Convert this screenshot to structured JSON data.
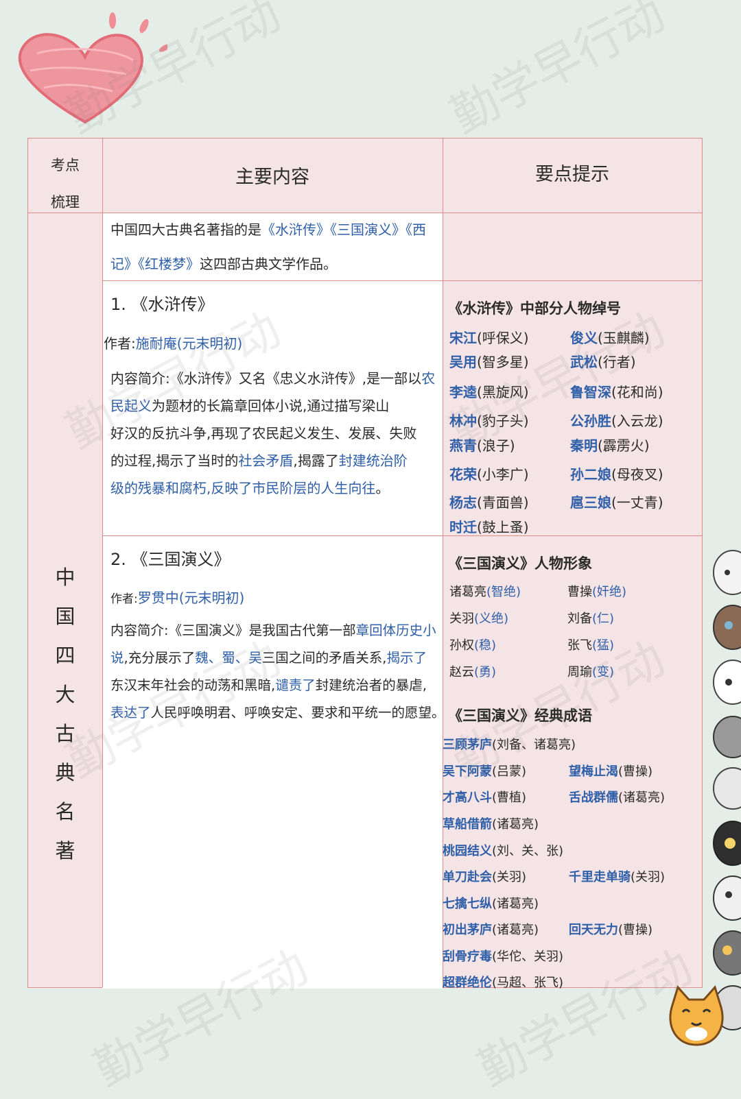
{
  "watermark": "勤学早行动",
  "header": {
    "col1_line1": "考点",
    "col1_line2": "梳理",
    "col2": "主要内容",
    "col3": "要点提示"
  },
  "side_title": [
    "中",
    "国",
    "四",
    "大",
    "古",
    "典",
    "名",
    "著"
  ],
  "intro": {
    "a": "中国四大古典名著指的是",
    "b": "《水浒传》《三国演义》《西",
    "c": "记》《红楼梦》",
    "d": "这四部古典文学作品。"
  },
  "shuihu": {
    "title": "1. 《水浒传》",
    "author_label": "作者:",
    "author": "施耐庵(元末明初)",
    "l1_a": "内容简介:《水浒传》又名《忠义水浒传》,是一部以",
    "l1_b": "农",
    "l2_a": "民起义",
    "l2_b": "为题材的长篇章回体小说,通过描写梁山",
    "l3": "好汉的反抗斗争,再现了农民起义发生、发展、失败",
    "l4_a": "的过程,揭示了当时的",
    "l4_b": "社会矛盾",
    "l4_c": ",揭露了",
    "l4_d": "封建统治阶",
    "l5_a": "级的残暴和腐朽,反映了市民阶层的人生向往",
    "l5_b": "。"
  },
  "shuihu_tips": {
    "title": "《水浒传》中部分人物绰号",
    "rows": [
      [
        {
          "n": "宋江",
          "t": "(呼保义)"
        },
        {
          "n": "俊义",
          "t": "(玉麒麟)"
        }
      ],
      [
        {
          "n": "吴用",
          "t": "(智多星)"
        },
        {
          "n": "武松",
          "t": "(行者)"
        }
      ],
      [
        {
          "n": "李逵",
          "t": "(黑旋风)"
        },
        {
          "n": "鲁智深",
          "t": "(花和尚)"
        }
      ],
      [
        {
          "n": "林冲",
          "t": "(豹子头)"
        },
        {
          "n": "公孙胜",
          "t": "(入云龙)"
        }
      ],
      [
        {
          "n": "燕青",
          "t": "(浪子)"
        },
        {
          "n": "秦明",
          "t": "(霹雳火)"
        }
      ],
      [
        {
          "n": "花荣",
          "t": "(小李广)"
        },
        {
          "n": "孙二娘",
          "t": "(母夜叉)"
        }
      ],
      [
        {
          "n": "杨志",
          "t": "(青面兽)"
        },
        {
          "n": "扈三娘",
          "t": "(一丈青)"
        }
      ],
      [
        {
          "n": "时迁",
          "t": "(鼓上蚤)"
        }
      ]
    ]
  },
  "sanguo": {
    "title": "2. 《三国演义》",
    "author_label": "作者:",
    "author": "罗贯中(元末明初)",
    "l1_a": "内容简介:《三国演义》是我国古代第一部",
    "l1_b": "章回体历史小",
    "l2_a": "说",
    "l2_b": ",充分展示了",
    "l2_c": "魏、蜀、吴",
    "l2_d": "三国之间的矛盾关系,",
    "l2_e": "揭示了",
    "l3_a": "东汉末年社会的动荡和黑暗,",
    "l3_b": "谴责了",
    "l3_c": "封建统治者的暴虐,",
    "l4_a": "表达了",
    "l4_b": "人民呼唤明君、呼唤安定、要求和平统一的愿望。"
  },
  "sanguo_chars": {
    "title": "《三国演义》人物形象",
    "rows": [
      [
        {
          "n": "诸葛亮",
          "t": "(智绝)"
        },
        {
          "n": "曹操",
          "t": "(奸绝)"
        }
      ],
      [
        {
          "n": "关羽",
          "t": "(义绝)"
        },
        {
          "n": "刘备",
          "t": "(仁)"
        }
      ],
      [
        {
          "n": "孙权",
          "t": "(稳)"
        },
        {
          "n": "张飞",
          "t": "(猛)"
        }
      ],
      [
        {
          "n": "赵云",
          "t": "(勇)"
        },
        {
          "n": "周瑜",
          "t": "(变)"
        }
      ]
    ]
  },
  "sanguo_idioms": {
    "title": "《三国演义》经典成语",
    "rows": [
      [
        {
          "i": "三顾茅庐",
          "p": "(刘备、诸葛亮)"
        }
      ],
      [
        {
          "i": "吴下阿蒙",
          "p": "(吕蒙)"
        },
        {
          "i": "望梅止渴",
          "p": "(曹操)"
        }
      ],
      [
        {
          "i": "才高八斗",
          "p": "(曹植)"
        },
        {
          "i": "舌战群儒",
          "p": "(诸葛亮)"
        }
      ],
      [
        {
          "i": "草船借箭",
          "p": "(诸葛亮)"
        }
      ],
      [
        {
          "i": "桃园结义",
          "p": "(刘、关、张)"
        }
      ],
      [
        {
          "i": "单刀赴会",
          "p": "(关羽)"
        },
        {
          "i": "千里走单骑",
          "p": "(关羽)"
        }
      ],
      [
        {
          "i": "七擒七纵",
          "p": "(诸葛亮)"
        }
      ],
      [
        {
          "i": "初出茅庐",
          "p": "(诸葛亮)"
        },
        {
          "i": "回天无力",
          "p": "(曹操)"
        }
      ],
      [
        {
          "i": "刮骨疗毒",
          "p": "(华佗、关羽)"
        }
      ],
      [
        {
          "i": "超群绝伦",
          "p": "(马超、张飞)"
        }
      ]
    ]
  }
}
